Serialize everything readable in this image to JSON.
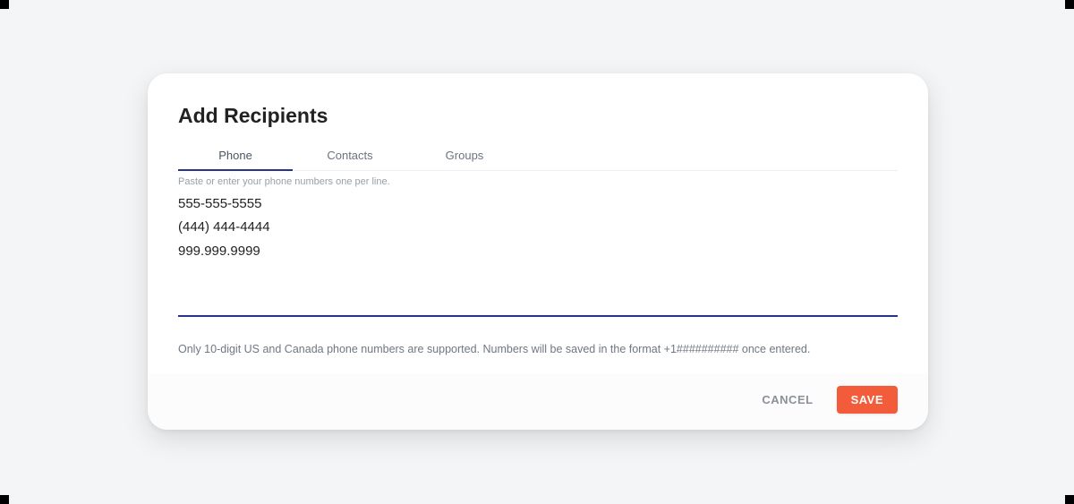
{
  "modal": {
    "title": "Add Recipients",
    "tabs": {
      "phone": "Phone",
      "contacts": "Contacts",
      "groups": "Groups"
    },
    "field_label": "Paste or enter your phone numbers one per line.",
    "phone_value": "555-555-5555\n(444) 444-4444\n999.999.9999",
    "helper_text": "Only 10-digit US and Canada phone numbers are supported. Numbers will be saved in the format +1########## once entered.",
    "buttons": {
      "cancel": "CANCEL",
      "save": "SAVE"
    }
  }
}
